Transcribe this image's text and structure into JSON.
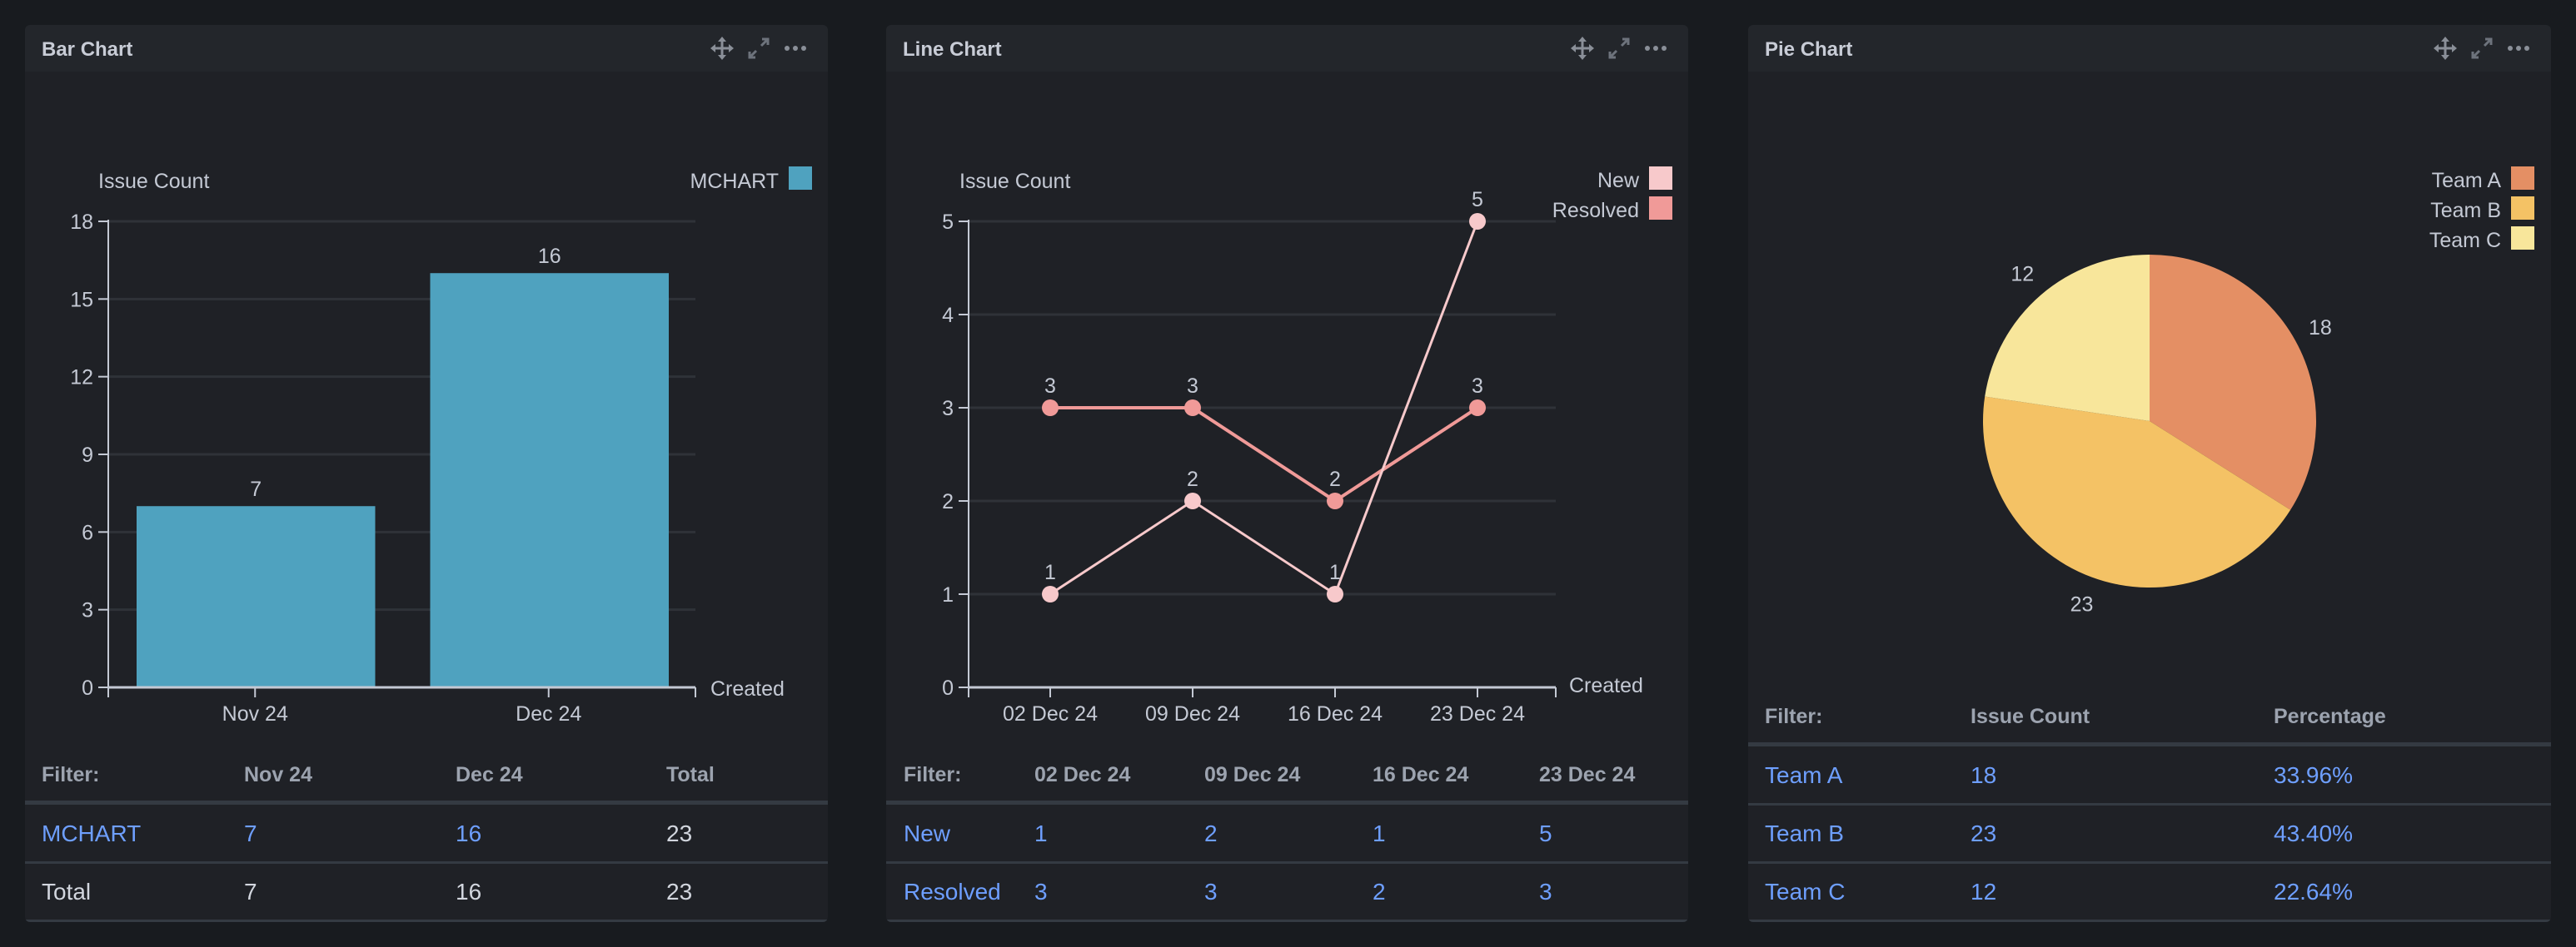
{
  "header_icons": {
    "move": "move-icon",
    "expand": "expand-icon",
    "more": "more-icon"
  },
  "colors": {
    "bar": "#4fa2bf",
    "new": "#f7c9cb",
    "resolved": "#f09a98",
    "team_a": "#e48f64",
    "team_b": "#f4c265",
    "team_c": "#f8e69b",
    "link": "#6e9fff"
  },
  "chart_data": [
    {
      "type": "bar",
      "title": "Bar Chart",
      "ylabel": "Issue Count",
      "xlabel": "Created",
      "categories": [
        "Nov 24",
        "Dec 24"
      ],
      "series": [
        {
          "name": "MCHART",
          "values": [
            7,
            16
          ]
        }
      ],
      "ylim": [
        0,
        18
      ],
      "yticks": [
        0,
        3,
        6,
        9,
        12,
        15,
        18
      ],
      "grid": true,
      "legend": "top-right"
    },
    {
      "type": "line",
      "title": "Line Chart",
      "ylabel": "Issue Count",
      "xlabel": "Created",
      "categories": [
        "02 Dec 24",
        "09 Dec 24",
        "16 Dec 24",
        "23 Dec 24"
      ],
      "series": [
        {
          "name": "New",
          "values": [
            1,
            2,
            1,
            5
          ]
        },
        {
          "name": "Resolved",
          "values": [
            3,
            3,
            2,
            3
          ]
        }
      ],
      "ylim": [
        0,
        5
      ],
      "yticks": [
        0,
        1,
        2,
        3,
        4,
        5
      ],
      "grid": true,
      "legend": "top-right"
    },
    {
      "type": "pie",
      "title": "Pie Chart",
      "categories": [
        "Team A",
        "Team B",
        "Team C"
      ],
      "values": [
        18,
        23,
        12
      ],
      "legend": "top-right"
    }
  ],
  "tables": {
    "bar": {
      "headers": [
        "Filter:",
        "Nov 24",
        "Dec 24",
        "Total"
      ],
      "rows": [
        [
          "MCHART",
          "7",
          "16",
          "23"
        ],
        [
          "Total",
          "7",
          "16",
          "23"
        ]
      ]
    },
    "line": {
      "headers": [
        "Filter:",
        "02 Dec 24",
        "09 Dec 24",
        "16 Dec 24",
        "23 Dec 24"
      ],
      "rows": [
        [
          "New",
          "1",
          "2",
          "1",
          "5"
        ],
        [
          "Resolved",
          "3",
          "3",
          "2",
          "3"
        ]
      ]
    },
    "pie": {
      "headers": [
        "Filter:",
        "Issue Count",
        "Percentage"
      ],
      "rows": [
        [
          "Team A",
          "18",
          "33.96%"
        ],
        [
          "Team B",
          "23",
          "43.40%"
        ],
        [
          "Team C",
          "12",
          "22.64%"
        ]
      ]
    }
  }
}
